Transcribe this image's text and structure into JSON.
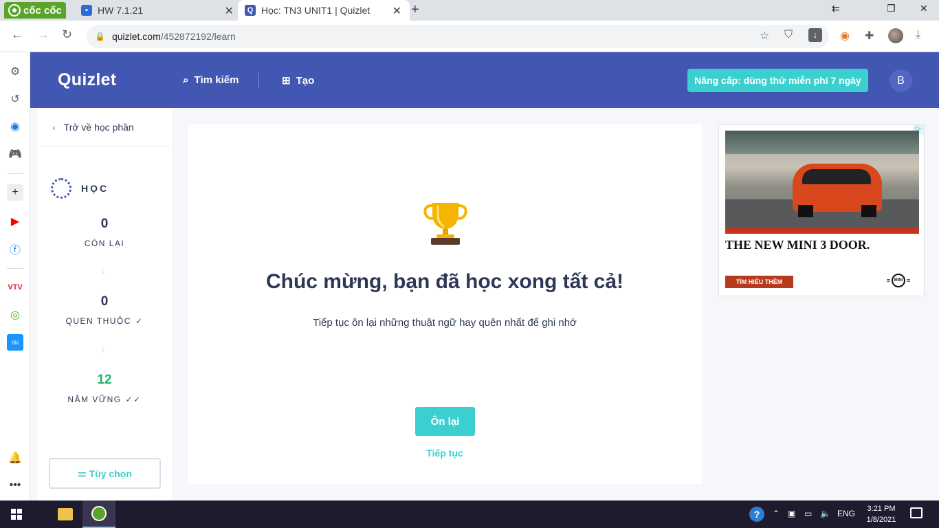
{
  "browser": {
    "brand": "cốc cốc",
    "tabs": [
      {
        "title": "HW 7.1.21",
        "active": false
      },
      {
        "title": "Học: TN3 UNIT1 | Quizlet",
        "active": true
      }
    ],
    "url_host": "quizlet.com",
    "url_path": "/452872192/learn",
    "window_controls": [
      "minimize",
      "restore",
      "close"
    ]
  },
  "header": {
    "logo": "Quizlet",
    "search_label": "Tìm kiếm",
    "create_label": "Tạo",
    "upgrade_label": "Nâng cấp: dùng thử miễn phí 7 ngày",
    "user_initial": "B"
  },
  "progress_panel": {
    "back_label": "Trở về học phần",
    "mode_title": "HỌC",
    "remaining": {
      "value": "0",
      "label": "CÒN LẠI"
    },
    "familiar": {
      "value": "0",
      "label": "QUEN THUỘC"
    },
    "mastered": {
      "value": "12",
      "label": "NẮM VỮNG"
    },
    "options_label": "Tùy chọn"
  },
  "main": {
    "title": "Chúc mừng, bạn đã học xong tất cả!",
    "subtitle": "Tiếp tục ôn lại những thuật ngữ hay quên nhất để ghi nhớ",
    "review_button": "Ôn lại",
    "continue_link": "Tiếp tục"
  },
  "ad": {
    "headline": "THE NEW MINI 3 DOOR.",
    "cta": "TÌM HIỂU THÊM",
    "brand": "MINI"
  },
  "taskbar": {
    "language": "ENG",
    "time": "3:21 PM",
    "date": "1/8/2021"
  },
  "colors": {
    "quizlet_blue": "#4257b2",
    "teal": "#3ccfcf",
    "mastered_green": "#23b26d",
    "text_dark": "#2e3856"
  }
}
